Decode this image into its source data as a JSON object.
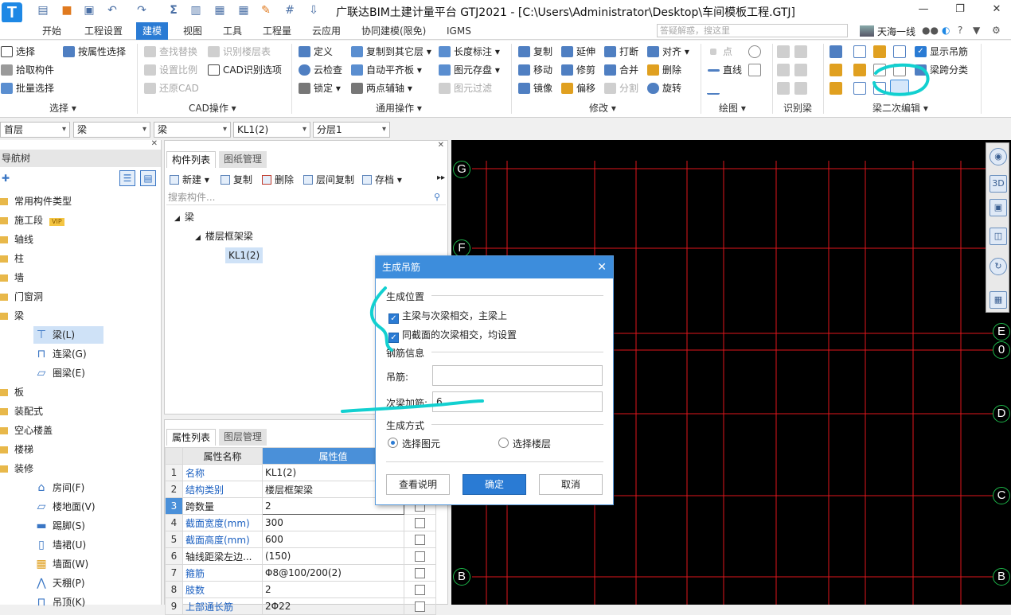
{
  "app": {
    "logo": "T",
    "title": "广联达BIM土建计量平台 GTJ2021 - [C:\\Users\\Administrator\\Desktop\\车间模板工程.GTJ]",
    "quick_access_icons": [
      "file-icon",
      "open-icon",
      "save-icon",
      "undo-icon",
      "redo-icon",
      "sum-icon",
      "report-icon",
      "check-icon",
      "table-icon",
      "grid-icon",
      "print-icon",
      "export-icon"
    ]
  },
  "menu": {
    "tabs": [
      "开始",
      "工程设置",
      "建模",
      "视图",
      "工具",
      "工程量",
      "云应用",
      "协同建模(限免)",
      "IGMS"
    ],
    "active": "建模",
    "search_placeholder": "答疑解惑，搜这里",
    "user_name": "天海一线"
  },
  "ribbon": {
    "select_group": {
      "label": "选择",
      "items": [
        "选择",
        "按属性选择",
        "拾取构件",
        "批量选择"
      ]
    },
    "cad_group": {
      "label": "CAD操作",
      "items": [
        "查找替换",
        "识别楼层表",
        "设置比例",
        "CAD识别选项",
        "还原CAD"
      ]
    },
    "common_group": {
      "label": "通用操作",
      "items": [
        "定义",
        "复制到其它层",
        "长度标注",
        "云检查",
        "自动平齐板",
        "图元存盘",
        "锁定",
        "两点辅轴",
        "图元过滤"
      ]
    },
    "modify_group": {
      "label": "修改",
      "items": [
        "复制",
        "延伸",
        "打断",
        "对齐",
        "移动",
        "修剪",
        "合并",
        "删除",
        "镜像",
        "偏移",
        "分割",
        "旋转"
      ]
    },
    "draw_group": {
      "label": "绘图",
      "items": [
        "点",
        "直线"
      ]
    },
    "identify_group": {
      "label": "识别梁"
    },
    "beam_edit_group": {
      "label": "梁二次编辑",
      "items": [
        "显示吊筋",
        "梁跨分类"
      ]
    }
  },
  "filters": [
    "首层",
    "梁",
    "梁",
    "KL1(2)",
    "分层1"
  ],
  "nav": {
    "title": "导航树",
    "items": [
      "常用构件类型",
      "施工段",
      "轴线",
      "柱",
      "墙",
      "门窗洞",
      "梁",
      "板",
      "装配式",
      "空心楼盖",
      "楼梯",
      "装修"
    ],
    "beam_children": [
      "梁(L)",
      "连梁(G)",
      "圈梁(E)"
    ],
    "finish_children": [
      "房间(F)",
      "楼地面(V)",
      "踢脚(S)",
      "墙裙(U)",
      "墙面(W)",
      "天棚(P)",
      "吊顶(K)"
    ],
    "vip_badge": "VIP"
  },
  "components": {
    "tabs": [
      "构件列表",
      "图纸管理"
    ],
    "toolbar": [
      "新建",
      "复制",
      "删除",
      "层间复制",
      "存档"
    ],
    "search_placeholder": "搜索构件...",
    "tree": {
      "root": "梁",
      "child": "楼层框架梁",
      "leaf": "KL1(2)"
    }
  },
  "properties": {
    "tabs": [
      "属性列表",
      "图层管理"
    ],
    "headers": [
      "属性名称",
      "属性值"
    ],
    "rows": [
      {
        "n": "1",
        "name": "名称",
        "value": "KL1(2)",
        "blue": true,
        "check": false
      },
      {
        "n": "2",
        "name": "结构类别",
        "value": "楼层框架梁",
        "blue": true,
        "check": true
      },
      {
        "n": "3",
        "name": "跨数量",
        "value": "2",
        "blue": false,
        "check": true
      },
      {
        "n": "4",
        "name": "截面宽度(mm)",
        "value": "300",
        "blue": true,
        "check": true
      },
      {
        "n": "5",
        "name": "截面高度(mm)",
        "value": "600",
        "blue": true,
        "check": true
      },
      {
        "n": "6",
        "name": "轴线距梁左边...",
        "value": "(150)",
        "blue": false,
        "check": true
      },
      {
        "n": "7",
        "name": "箍筋",
        "value": "Φ8@100/200(2)",
        "blue": true,
        "check": true
      },
      {
        "n": "8",
        "name": "肢数",
        "value": "2",
        "blue": true,
        "check": true
      },
      {
        "n": "9",
        "name": "上部通长筋",
        "value": "2Φ22",
        "blue": true,
        "check": true
      }
    ]
  },
  "canvas": {
    "axis_left": [
      "G",
      "F",
      "B"
    ],
    "axis_right": [
      "E",
      "0",
      "D",
      "C",
      "B"
    ],
    "grid_color": "#e0161c",
    "axis_color": "#1db84a",
    "view_tools": [
      "orbit-icon",
      "3d-icon",
      "top-view-icon",
      "box-view-icon",
      "rotate-icon",
      "layout-icon"
    ],
    "view_3d_label": "3D"
  },
  "dialog": {
    "title": "生成吊筋",
    "position_section": "生成位置",
    "option1": "主梁与次梁相交，主梁上",
    "option2": "同截面的次梁相交，均设置",
    "rebar_section": "钢筋信息",
    "hanger_label": "吊筋:",
    "hanger_value": "",
    "secondary_label": "次梁加筋:",
    "secondary_value": "6",
    "method_section": "生成方式",
    "radio1": "选择图元",
    "radio2": "选择楼层",
    "btn_help": "查看说明",
    "btn_ok": "确定",
    "btn_cancel": "取消"
  }
}
